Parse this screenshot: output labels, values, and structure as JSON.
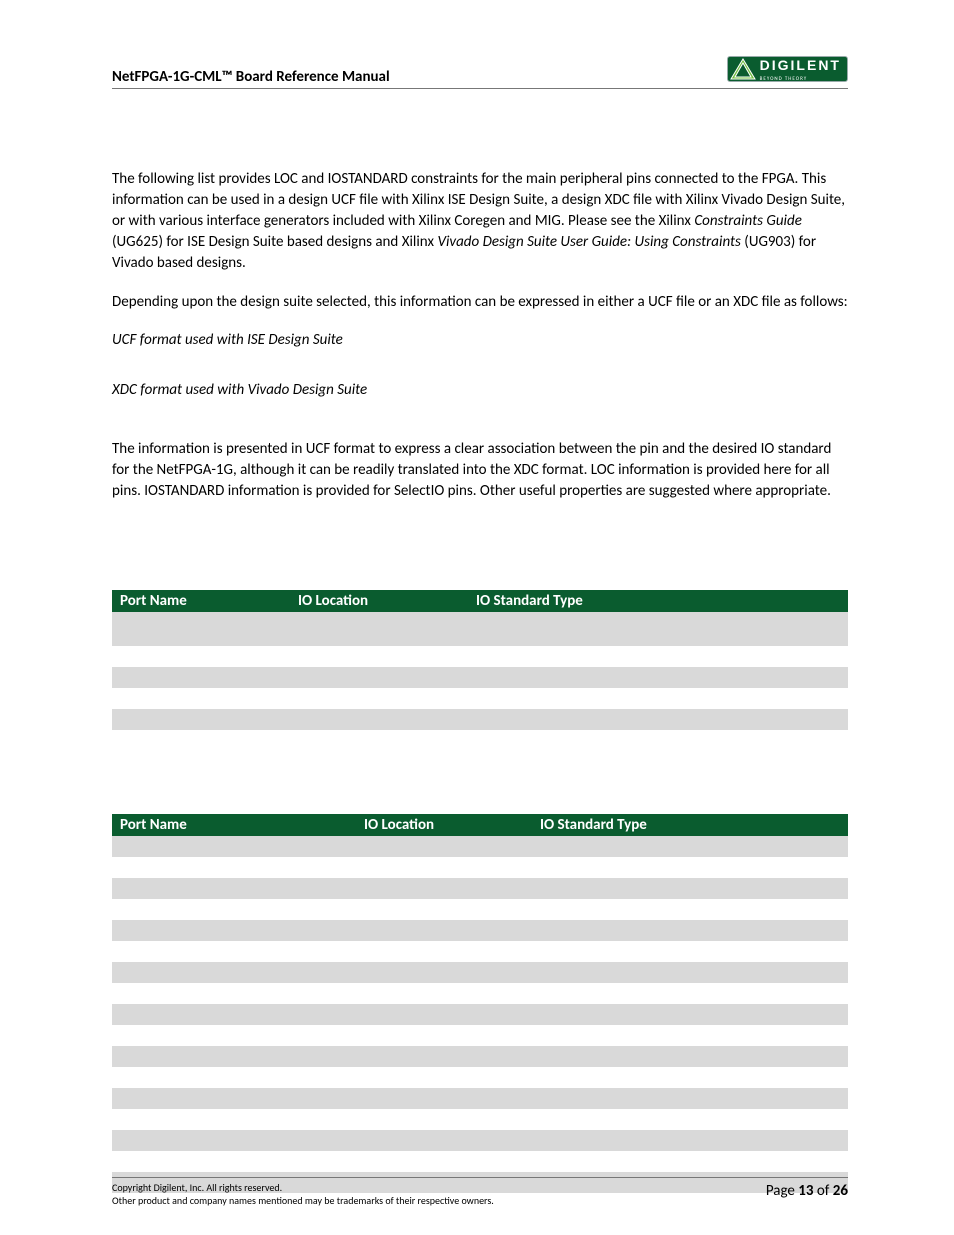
{
  "header": {
    "title": "NetFPGA-1G-CML™ Board Reference Manual",
    "logo_text": "DIGILENT",
    "logo_sub": "BEYOND THEORY"
  },
  "body": {
    "p1_a": "The following list provides LOC and IOSTANDARD constraints for the main peripheral pins connected to the FPGA. This information can be used in a design UCF file with Xilinx ISE Design Suite, a design XDC file with Xilinx Vivado Design Suite, or with various interface generators included with Xilinx Coregen and MIG. Please see the Xilinx ",
    "p1_i1": "Constraints Guide",
    "p1_b": " (UG625) for ISE Design Suite based designs and Xilinx ",
    "p1_i2": "Vivado Design Suite User Guide: Using Constraints",
    "p1_c": " (UG903) for Vivado based designs.",
    "p2": "Depending upon the design suite selected, this information can be expressed in either a UCF file or an XDC file as follows:",
    "p3": "UCF format used with ISE Design Suite",
    "p4": "XDC format used with Vivado Design Suite",
    "p5": "The information is presented in UCF format to express a clear association between the pin and the desired IO standard for the NetFPGA-1G, although it can be readily translated into the XDC format. LOC information is provided here for all pins. IOSTANDARD information is provided for SelectIO pins. Other useful properties are suggested where appropriate."
  },
  "table_headers": {
    "port_name": "Port Name",
    "io_location": "IO Location",
    "io_standard": "IO Standard Type"
  },
  "footer": {
    "copyright": "Copyright Digilent, Inc. All rights reserved.",
    "trademark": "Other product and company names mentioned may be trademarks of their respective owners.",
    "page_label": "Page ",
    "page_num": "13",
    "page_of": " of ",
    "page_total": "26"
  }
}
